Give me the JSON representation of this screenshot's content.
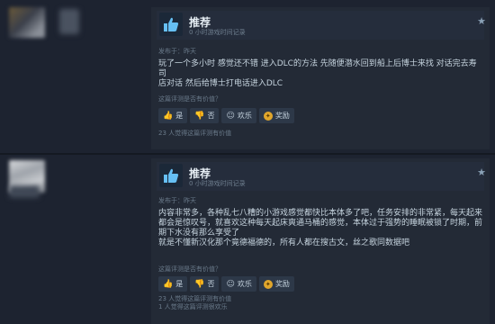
{
  "reviews": [
    {
      "recommendation": "推荐",
      "hours": "0 小时游戏时间记录",
      "posted": "发布于：昨天",
      "body": [
        "玩了一个多小时 感觉还不错 进入DLC的方法 先随便潜水回到船上后博士来找 对话完去寿司",
        "店对话 然后给博士打电话进入DLC"
      ],
      "helpful_question": "这篇评测是否有价值？",
      "buttons": {
        "yes": "是",
        "no": "否",
        "funny": "欢乐",
        "award": "奖励"
      },
      "stats": [
        "23 人觉得这篇评测有价值"
      ]
    },
    {
      "recommendation": "推荐",
      "hours": "0 小时游戏时间记录",
      "posted": "发布于：昨天",
      "body": [
        "内容非常多，各种乱七八糟的小游戏感觉都快比本体多了吧，任务安排的非常紧，每天起来",
        "都会是惊叹号，就喜欢这种每天起床爽通马桶的感觉，本体过于强势的睡眠被锁了时期，前",
        "期下水没有那么享受了",
        "就是不懂新汉化那个竟德福德的，所有人都在搜古文，丝之歌同数据吧"
      ],
      "helpful_question": "这篇评测是否有价值？",
      "buttons": {
        "yes": "是",
        "no": "否",
        "funny": "欢乐",
        "award": "奖励"
      },
      "stats": [
        "23 人觉得这篇评测有价值",
        "1 人觉得这篇评测很欢乐"
      ]
    }
  ],
  "icons": {
    "thumb": "thumbs-up-icon",
    "star": "star-icon",
    "award": "award-icon"
  },
  "colors": {
    "background": "#1d2330",
    "card": "#232a36",
    "accent": "#66c0f4",
    "award": "#e0a62c"
  }
}
